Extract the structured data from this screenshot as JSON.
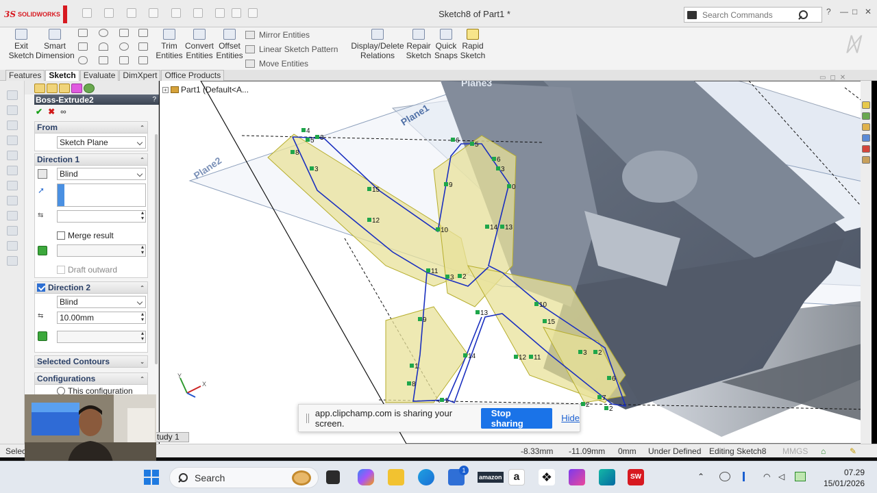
{
  "app": {
    "name": "SOLIDWORKS",
    "title": "Sketch8 of Part1 *"
  },
  "search": {
    "placeholder": "Search Commands"
  },
  "ribbon": {
    "exit_sketch": [
      "Exit",
      "Sketch"
    ],
    "smart_dimension": [
      "Smart",
      "Dimension"
    ],
    "trim": [
      "Trim",
      "Entities"
    ],
    "convert": [
      "Convert",
      "Entities"
    ],
    "offset": [
      "Offset",
      "Entities"
    ],
    "mirror": "Mirror Entities",
    "linear_pattern": "Linear Sketch Pattern",
    "move": "Move Entities",
    "display_delete": [
      "Display/Delete",
      "Relations"
    ],
    "repair": [
      "Repair",
      "Sketch"
    ],
    "quick_snaps": [
      "Quick",
      "Snaps"
    ],
    "rapid_sketch": [
      "Rapid",
      "Sketch"
    ]
  },
  "tabs": [
    "Features",
    "Sketch",
    "Evaluate",
    "DimXpert",
    "Office Products"
  ],
  "active_tab": "Sketch",
  "property_manager": {
    "title": "Boss-Extrude2",
    "from": {
      "label": "From",
      "value": "Sketch Plane"
    },
    "direction1": {
      "label": "Direction 1",
      "end_condition": "Blind",
      "depth": "",
      "merge_result": "Merge result",
      "draft_outward": "Draft outward"
    },
    "direction2": {
      "label": "Direction 2",
      "end_condition": "Blind",
      "depth": "10.00mm"
    },
    "selected_contours": "Selected Contours",
    "configurations": "Configurations",
    "this_configuration": "This configuration"
  },
  "tree": {
    "root": "Part1  (Default<A..."
  },
  "planes": [
    "Plane1",
    "Plane2",
    "Plane3"
  ],
  "sketch_labels": [
    {
      "t": "4"
    },
    {
      "t": "5"
    },
    {
      "t": "3"
    },
    {
      "t": "8"
    },
    {
      "t": "3"
    },
    {
      "t": "15"
    },
    {
      "t": "12"
    },
    {
      "t": "6"
    },
    {
      "t": "5"
    },
    {
      "t": "6"
    },
    {
      "t": "3"
    },
    {
      "t": "0"
    },
    {
      "t": "9"
    },
    {
      "t": "14"
    },
    {
      "t": "13"
    },
    {
      "t": "10"
    },
    {
      "t": "11"
    },
    {
      "t": "3"
    },
    {
      "t": "2"
    },
    {
      "t": "9"
    },
    {
      "t": "13"
    },
    {
      "t": "10"
    },
    {
      "t": "15"
    },
    {
      "t": "14"
    },
    {
      "t": "12"
    },
    {
      "t": "11"
    },
    {
      "t": "3"
    },
    {
      "t": "2"
    },
    {
      "t": "1"
    },
    {
      "t": "8"
    },
    {
      "t": "1"
    },
    {
      "t": "6"
    },
    {
      "t": "7"
    },
    {
      "t": "2"
    },
    {
      "t": "2"
    }
  ],
  "status": {
    "left": "Selec",
    "study_tab": "tudy 1",
    "x": "-8.33mm",
    "y": "-11.09mm",
    "z": "0mm",
    "state": "Under Defined",
    "editing": "Editing Sketch8",
    "units": "MMGS"
  },
  "share_bar": {
    "message": "app.clipchamp.com is sharing your screen.",
    "stop": "Stop sharing",
    "hide": "Hide"
  },
  "taskbar": {
    "search_label": "Search",
    "time": "07.29",
    "date": "15/01/2026",
    "store_badge": "1",
    "amazon": "amazon"
  }
}
